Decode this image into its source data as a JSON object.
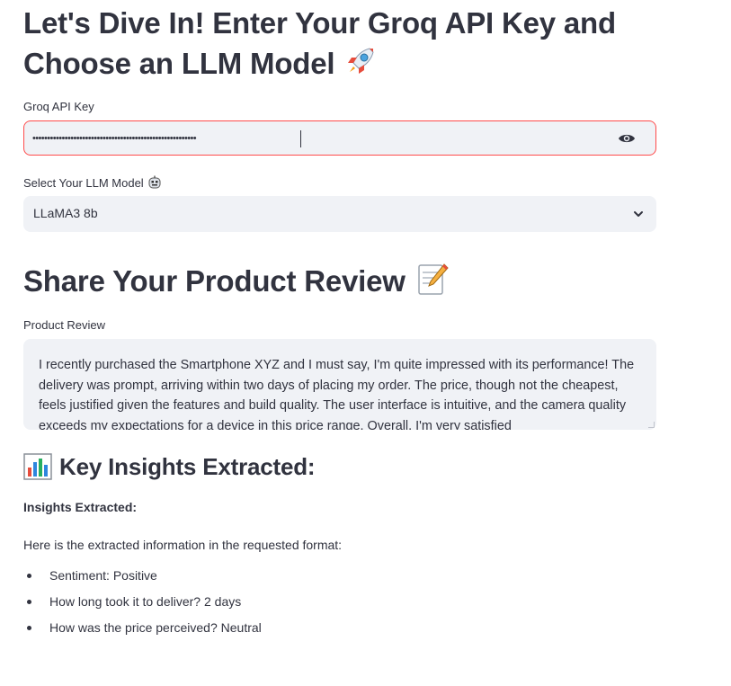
{
  "heading_main": {
    "text": "Let's Dive In! Enter Your Groq API Key and Choose an LLM Model",
    "icon": "rocket-icon"
  },
  "api_key": {
    "label": "Groq API Key",
    "masked_value": "••••••••••••••••••••••••••••••••••••••••••••••••••••••••",
    "toggle_icon": "eye-icon"
  },
  "model_select": {
    "label": "Select Your LLM Model",
    "label_icon": "robot-face-icon",
    "value": "LLaMA3 8b",
    "chevron_icon": "chevron-down-icon"
  },
  "heading_review": {
    "text": "Share Your Product Review",
    "icon": "memo-icon"
  },
  "review": {
    "label": "Product Review",
    "text": "I recently purchased the Smartphone XYZ and I must say, I'm quite impressed with its performance! The delivery was prompt, arriving within two days of placing my order. The price, though not the cheapest, feels justified given the features and build quality. The user interface is intuitive, and the camera quality exceeds my expectations for a device in this price range. Overall, I'm very satisfied"
  },
  "insights": {
    "heading": "Key Insights Extracted:",
    "heading_icon": "bar-chart-icon",
    "bold_label": "Insights Extracted:",
    "intro": "Here is the extracted information in the requested format:",
    "items": [
      "Sentiment: Positive",
      "How long took it to deliver? 2 days",
      "How was the price perceived? Neutral"
    ]
  },
  "colors": {
    "accent_error": "#ff4b4b",
    "field_bg": "#f0f2f6",
    "text": "#31333f"
  }
}
